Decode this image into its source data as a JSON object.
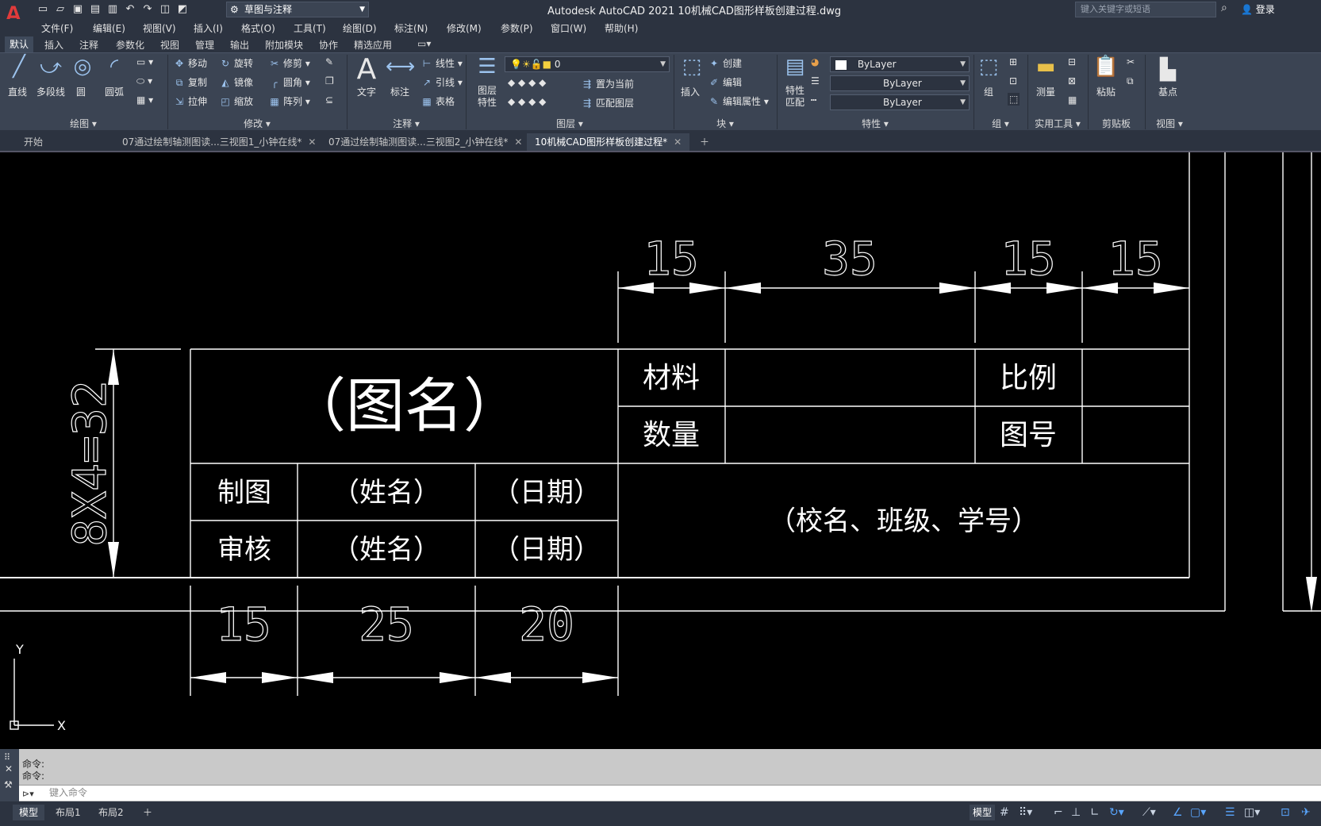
{
  "app": {
    "logo": "A",
    "window_title": "Autodesk AutoCAD 2021    10机械CAD图形样板创建过程.dwg",
    "workspace": "草图与注释",
    "search_placeholder": "键入关键字或短语",
    "user_label": "登录"
  },
  "menu": [
    "文件(F)",
    "编辑(E)",
    "视图(V)",
    "插入(I)",
    "格式(O)",
    "工具(T)",
    "绘图(D)",
    "标注(N)",
    "修改(M)",
    "参数(P)",
    "窗口(W)",
    "帮助(H)"
  ],
  "ribbon_tabs": [
    "默认",
    "插入",
    "注释",
    "参数化",
    "视图",
    "管理",
    "输出",
    "附加模块",
    "协作",
    "精选应用"
  ],
  "ribbon": {
    "draw": {
      "title": "绘图",
      "line": "直线",
      "polyline": "多段线",
      "circle": "圆",
      "arc": "圆弧"
    },
    "modify": {
      "title": "修改",
      "move": "移动",
      "rotate": "旋转",
      "trim": "修剪",
      "copy": "复制",
      "mirror": "镜像",
      "fillet": "圆角",
      "stretch": "拉伸",
      "scale": "缩放",
      "array": "阵列"
    },
    "annotation": {
      "title": "注释",
      "text": "文字",
      "dimension": "标注",
      "linear": "线性",
      "leader": "引线",
      "table": "表格"
    },
    "layers": {
      "title": "图层",
      "layer_props": "图层\n特性",
      "current_layer": "0",
      "set_current": "置为当前",
      "match_layer": "匹配图层"
    },
    "block": {
      "title": "块",
      "insert": "插入",
      "create": "创建",
      "edit": "编辑",
      "edit_attr": "编辑属性"
    },
    "properties": {
      "title": "特性",
      "match": "特性\n匹配",
      "color": "ByLayer",
      "linetype": "ByLayer",
      "lineweight": "ByLayer"
    },
    "group": {
      "title": "组",
      "group": "组"
    },
    "utilities": {
      "title": "实用工具",
      "measure": "测量"
    },
    "clipboard": {
      "title": "剪贴板",
      "paste": "粘贴"
    },
    "view": {
      "title": "视图",
      "base": "基点"
    }
  },
  "doc_tabs": [
    {
      "label": "开始",
      "active": false,
      "closable": false
    },
    {
      "label": "07通过绘制轴测图读...三视图1_小钟在线*",
      "active": false,
      "closable": true
    },
    {
      "label": "07通过绘制轴测图读...三视图2_小钟在线*",
      "active": false,
      "closable": true
    },
    {
      "label": "10机械CAD图形样板创建过程*",
      "active": true,
      "closable": true
    }
  ],
  "drawing": {
    "title_cell": "（图名）",
    "material": "材料",
    "quantity": "数量",
    "scale": "比例",
    "drawing_no": "图号",
    "drafter": "制图",
    "reviewer": "审核",
    "name1": "（姓名）",
    "name2": "（姓名）",
    "date1": "（日期）",
    "date2": "（日期）",
    "school": "（校名、班级、学号）",
    "dim_top": [
      "15",
      "35",
      "15",
      "15"
    ],
    "dim_bottom": [
      "15",
      "25",
      "20"
    ],
    "dim_side": "8X4=32",
    "ucs_x": "X",
    "ucs_y": "Y"
  },
  "command": {
    "history": [
      "命令:",
      "命令:"
    ],
    "placeholder": "键入命令"
  },
  "layout_tabs": [
    "模型",
    "布局1",
    "布局2"
  ],
  "icons": [
    "new-icon",
    "open-icon",
    "save-icon",
    "saveas-icon",
    "print-icon",
    "undo-icon",
    "redo-icon",
    "search-icon",
    "user-icon",
    "close-icon",
    "add-tab-icon",
    "grid-icon",
    "snap-icon",
    "ortho-icon",
    "polar-icon"
  ]
}
